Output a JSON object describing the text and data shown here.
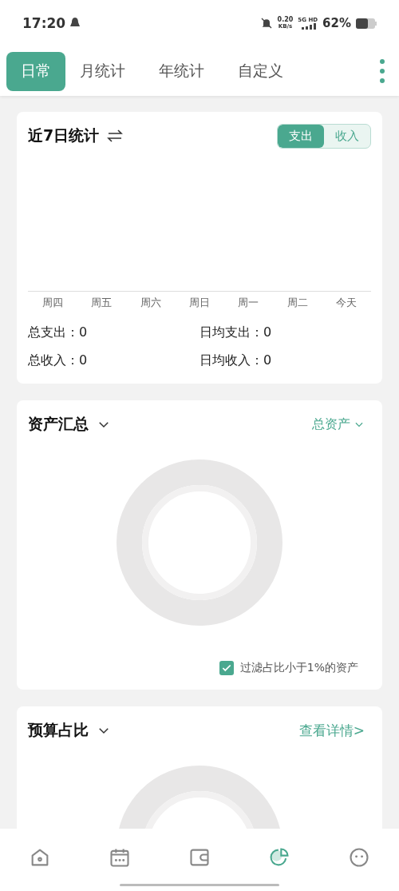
{
  "status_bar": {
    "time": "17:20",
    "net_speed": "0.20",
    "net_unit": "KB/s",
    "network": "5G HD",
    "battery": "62%"
  },
  "tabs": [
    {
      "label": "日常",
      "selected": true
    },
    {
      "label": "月统计",
      "selected": false
    },
    {
      "label": "年统计",
      "selected": false
    },
    {
      "label": "自定义",
      "selected": false
    }
  ],
  "weekly": {
    "title": "近7日统计",
    "toggle": [
      {
        "label": "支出",
        "selected": true
      },
      {
        "label": "收入",
        "selected": false
      }
    ],
    "days": [
      "周四",
      "周五",
      "周六",
      "周日",
      "周一",
      "周二",
      "今天"
    ],
    "stats": [
      "总支出：0",
      "日均支出：0",
      "总收入：0",
      "日均收入：0"
    ]
  },
  "assets": {
    "title": "资产汇总",
    "selector": "总资产",
    "filter": {
      "label": "过滤占比小于1%的资产",
      "checked": true
    }
  },
  "budget": {
    "title": "预算占比",
    "link": "查看详情>"
  },
  "nav": [
    {
      "kind": "home",
      "selected": false
    },
    {
      "kind": "calendar",
      "selected": false
    },
    {
      "kind": "wallet",
      "selected": false
    },
    {
      "kind": "chart",
      "selected": true
    },
    {
      "kind": "more",
      "selected": false
    }
  ]
}
